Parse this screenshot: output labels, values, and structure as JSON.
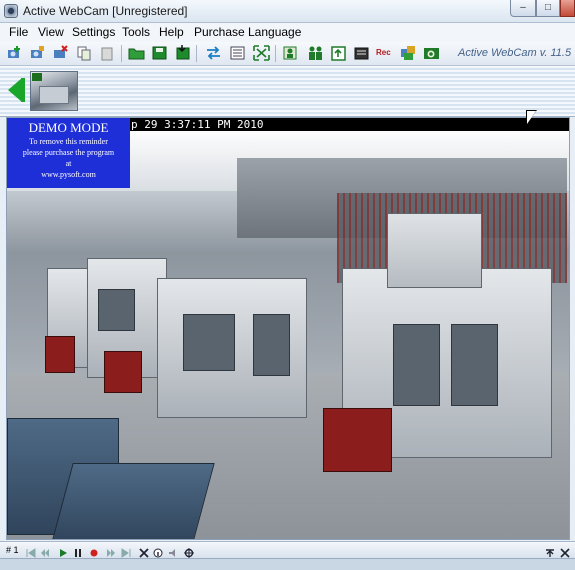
{
  "window": {
    "title": "Active WebCam [Unregistered]",
    "app_version": "Active WebCam v. 11.5"
  },
  "menu": [
    {
      "label": "File"
    },
    {
      "label": "View"
    },
    {
      "label": "Settings"
    },
    {
      "label": "Tools"
    },
    {
      "label": "Help"
    },
    {
      "label": "Purchase"
    },
    {
      "label": "Language"
    }
  ],
  "toolbar": {
    "icons": [
      "add-camera-icon",
      "camera-properties-icon",
      "remove-camera-icon",
      "copy-icon",
      "paste-icon",
      "open-icon",
      "save-icon",
      "save-all-icon",
      "connections-icon",
      "log-icon",
      "fullscreen-icon",
      "add-user-icon",
      "users-icon",
      "upload-icon",
      "schedule-icon",
      "record-icon",
      "broadcast-icon",
      "snapshot-icon"
    ],
    "record_label": "Rec"
  },
  "camera": {
    "number": "# 1",
    "timestamp": "p 29   3:37:11 PM  2010",
    "demo": {
      "title": "DEMO MODE",
      "lines": [
        "To remove this reminder",
        "please purchase the program",
        "at",
        "www.pysoft.com"
      ]
    }
  },
  "colors": {
    "accent": "#1f2fd8",
    "nav_green": "#19a62b",
    "version_text": "#44628a"
  }
}
